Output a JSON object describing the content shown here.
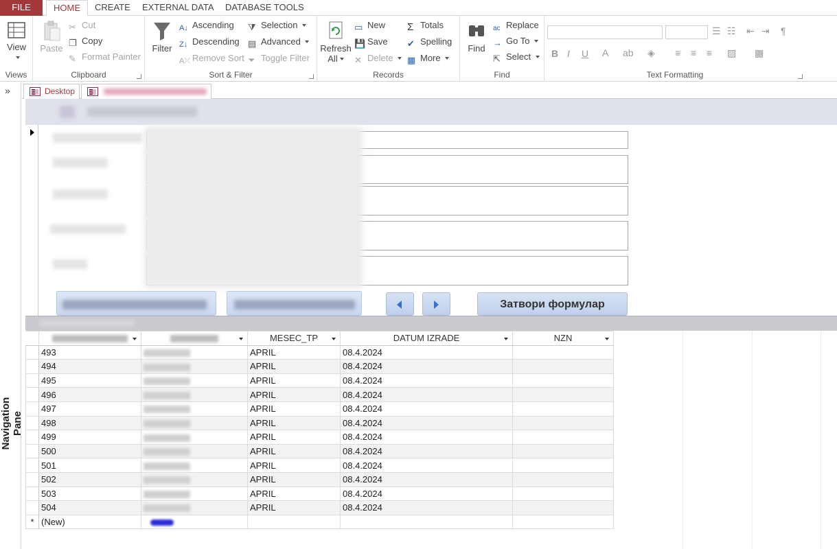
{
  "menu_tabs": [
    "FILE",
    "HOME",
    "CREATE",
    "EXTERNAL DATA",
    "DATABASE TOOLS"
  ],
  "ribbon": {
    "views": {
      "view_label": "View",
      "group_label": "Views"
    },
    "clipboard": {
      "paste": "Paste",
      "cut": "Cut",
      "copy": "Copy",
      "format_painter": "Format Painter",
      "group_label": "Clipboard"
    },
    "sort_filter": {
      "filter": "Filter",
      "ascending": "Ascending",
      "descending": "Descending",
      "remove_sort": "Remove Sort",
      "selection": "Selection",
      "advanced": "Advanced",
      "toggle_filter": "Toggle Filter",
      "group_label": "Sort & Filter"
    },
    "records": {
      "refresh_all": "Refresh All",
      "new": "New",
      "save": "Save",
      "delete": "Delete",
      "totals": "Totals",
      "spelling": "Spelling",
      "more": "More",
      "group_label": "Records"
    },
    "find": {
      "find": "Find",
      "replace": "Replace",
      "go_to": "Go To",
      "select": "Select",
      "group_label": "Find"
    },
    "text_formatting": {
      "bold": "B",
      "italic": "I",
      "underline": "U",
      "group_label": "Text Formatting"
    }
  },
  "navpane": {
    "label": "Navigation Pane",
    "toggle": "»"
  },
  "doc_tabs": [
    {
      "label": "Desktop"
    }
  ],
  "form": {
    "close_button": "Затвори формулар"
  },
  "datasheet": {
    "columns": [
      "MESEC_TP",
      "DATUM IZRADE",
      "NZN"
    ],
    "rows": [
      {
        "id": "493",
        "mesec": "APRIL",
        "datum": "08.4.2024"
      },
      {
        "id": "494",
        "mesec": "APRIL",
        "datum": "08.4.2024"
      },
      {
        "id": "495",
        "mesec": "APRIL",
        "datum": "08.4.2024"
      },
      {
        "id": "496",
        "mesec": "APRIL",
        "datum": "08.4.2024"
      },
      {
        "id": "497",
        "mesec": "APRIL",
        "datum": "08.4.2024"
      },
      {
        "id": "498",
        "mesec": "APRIL",
        "datum": "08.4.2024"
      },
      {
        "id": "499",
        "mesec": "APRIL",
        "datum": "08.4.2024"
      },
      {
        "id": "500",
        "mesec": "APRIL",
        "datum": "08.4.2024"
      },
      {
        "id": "501",
        "mesec": "APRIL",
        "datum": "08.4.2024"
      },
      {
        "id": "502",
        "mesec": "APRIL",
        "datum": "08.4.2024"
      },
      {
        "id": "503",
        "mesec": "APRIL",
        "datum": "08.4.2024"
      },
      {
        "id": "504",
        "mesec": "APRIL",
        "datum": "08.4.2024"
      }
    ],
    "new_row_marker": "*",
    "new_row_label": "(New)"
  },
  "colors": {
    "accent": "#a4373a",
    "form_header": "#dfe2ea",
    "button": "#c9d7ee"
  }
}
